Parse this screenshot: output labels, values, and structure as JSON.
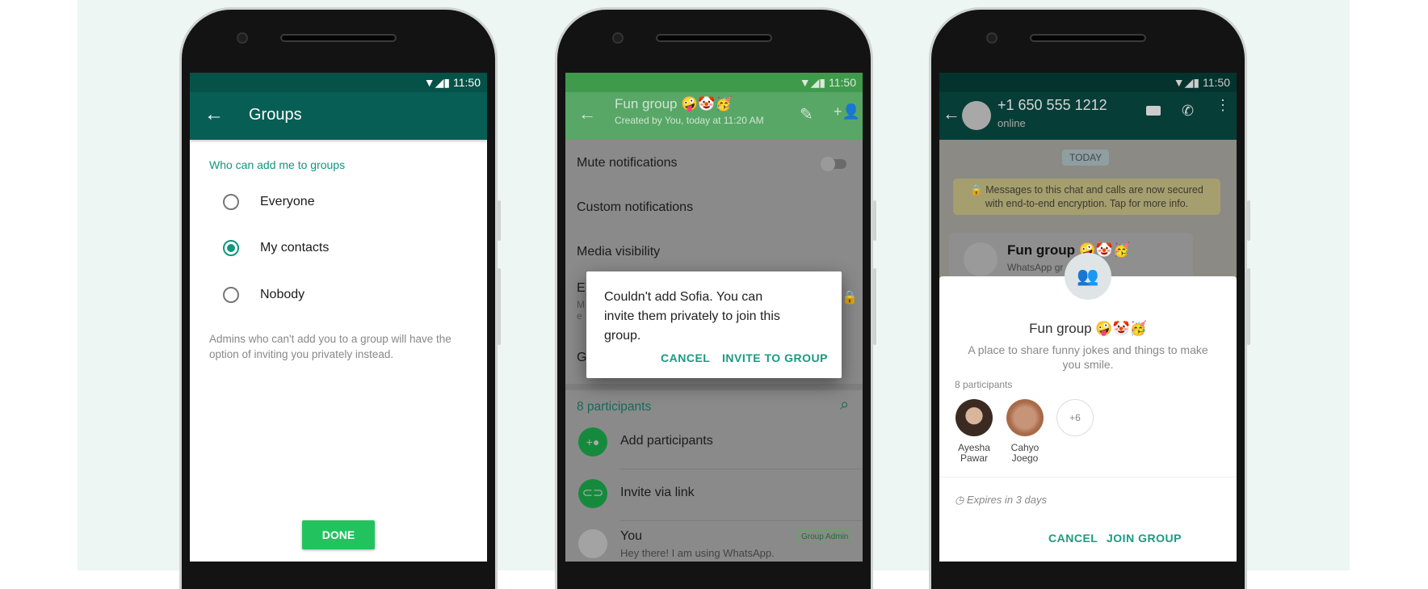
{
  "status_time": "11:50",
  "colors": {
    "teal": "#075e54",
    "accent": "#11967f",
    "green": "#25d366",
    "background": "#edf6f3"
  },
  "phone1": {
    "title": "Groups",
    "section": "Who can add me to groups",
    "options": [
      {
        "label": "Everyone",
        "selected": false
      },
      {
        "label": "My contacts",
        "selected": true
      },
      {
        "label": "Nobody",
        "selected": false
      }
    ],
    "note_lines": [
      "Admins who can't add you to a group will have the",
      "option of inviting you privately instead."
    ],
    "done": "DONE"
  },
  "phone2": {
    "title": "Fun group 🤪🤡🥳",
    "subtitle": "Created by You, today at 11:20 AM",
    "rows": [
      "Mute notifications",
      "Custom notifications",
      "Media visibility",
      "E",
      "G"
    ],
    "enc_partial": [
      "M",
      "e"
    ],
    "participants_label": "8 participants",
    "add_participants": "Add participants",
    "invite_link": "Invite via link",
    "you_name": "You",
    "you_status": "Hey there! I am using WhatsApp.",
    "admin_badge": "Group Admin",
    "dialog": {
      "lines": [
        "Couldn't add Sofia. You can",
        "invite them privately to join this",
        "group."
      ],
      "cancel": "CANCEL",
      "confirm": "INVITE TO GROUP"
    }
  },
  "phone3": {
    "contact": "+1 650 555 1212",
    "presence": "online",
    "date_chip": "TODAY",
    "encryption_lines": [
      "Messages to this chat and calls are now secured",
      "with end-to-end encryption. Tap for more info."
    ],
    "bubble_title": "Fun group 🤪🤡🥳",
    "bubble_sub": "WhatsApp gr",
    "sheet": {
      "title": "Fun group 🤪🤡🥳",
      "desc_lines": [
        "A place to share funny jokes and things to make",
        "you smile."
      ],
      "participants_label": "8 participants",
      "members": [
        {
          "first": "Ayesha",
          "last": "Pawar"
        },
        {
          "first": "Cahyo",
          "last": "Joego"
        }
      ],
      "more": "+6",
      "expires": "Expires in 3 days",
      "cancel": "CANCEL",
      "join": "JOIN GROUP"
    }
  }
}
